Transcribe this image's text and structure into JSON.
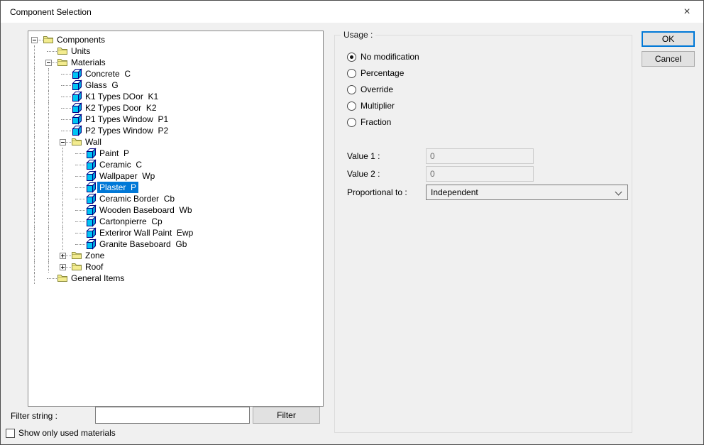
{
  "window": {
    "title": "Component Selection"
  },
  "icons": {
    "close_glyph": "×"
  },
  "tree": {
    "items": [
      {
        "label": "Components",
        "level": 0,
        "icon": "folder",
        "expander": "minus",
        "selected": false
      },
      {
        "label": "Units",
        "level": 1,
        "icon": "folder",
        "expander": null,
        "selected": false
      },
      {
        "label": "Materials",
        "level": 1,
        "icon": "folder",
        "expander": "minus",
        "selected": false
      },
      {
        "label": "Concrete  C",
        "level": 2,
        "icon": "material",
        "expander": null,
        "selected": false
      },
      {
        "label": "Glass  G",
        "level": 2,
        "icon": "material",
        "expander": null,
        "selected": false
      },
      {
        "label": "K1 Types DOor  K1",
        "level": 2,
        "icon": "material",
        "expander": null,
        "selected": false
      },
      {
        "label": "K2 Types Door  K2",
        "level": 2,
        "icon": "material",
        "expander": null,
        "selected": false
      },
      {
        "label": "P1 Types Window  P1",
        "level": 2,
        "icon": "material",
        "expander": null,
        "selected": false
      },
      {
        "label": "P2 Types Window  P2",
        "level": 2,
        "icon": "material",
        "expander": null,
        "selected": false
      },
      {
        "label": "Wall",
        "level": 2,
        "icon": "folder",
        "expander": "minus",
        "selected": false
      },
      {
        "label": "Paint  P",
        "level": 3,
        "icon": "material",
        "expander": null,
        "selected": false
      },
      {
        "label": "Ceramic  C",
        "level": 3,
        "icon": "material",
        "expander": null,
        "selected": false
      },
      {
        "label": "Wallpaper  Wp",
        "level": 3,
        "icon": "material",
        "expander": null,
        "selected": false
      },
      {
        "label": "Plaster  P",
        "level": 3,
        "icon": "material",
        "expander": null,
        "selected": true
      },
      {
        "label": "Ceramic Border  Cb",
        "level": 3,
        "icon": "material",
        "expander": null,
        "selected": false
      },
      {
        "label": "Wooden Baseboard  Wb",
        "level": 3,
        "icon": "material",
        "expander": null,
        "selected": false
      },
      {
        "label": "Cartonpierre  Cp",
        "level": 3,
        "icon": "material",
        "expander": null,
        "selected": false
      },
      {
        "label": "Exteriror Wall Paint  Ewp",
        "level": 3,
        "icon": "material",
        "expander": null,
        "selected": false
      },
      {
        "label": "Granite Baseboard  Gb",
        "level": 3,
        "icon": "material",
        "expander": null,
        "selected": false
      },
      {
        "label": "Zone",
        "level": 2,
        "icon": "folder",
        "expander": "plus",
        "selected": false
      },
      {
        "label": "Roof",
        "level": 2,
        "icon": "folder",
        "expander": "plus",
        "selected": false
      },
      {
        "label": "General Items",
        "level": 1,
        "icon": "folder",
        "expander": null,
        "selected": false
      }
    ]
  },
  "filter": {
    "label": "Filter string :",
    "input_value": "",
    "button_label": "Filter"
  },
  "show_only": {
    "label": "Show only used materials",
    "checked": false
  },
  "usage": {
    "group_label": "Usage :",
    "options": [
      {
        "label": "No modification",
        "selected": true
      },
      {
        "label": "Percentage",
        "selected": false
      },
      {
        "label": "Override",
        "selected": false
      },
      {
        "label": "Multiplier",
        "selected": false
      },
      {
        "label": "Fraction",
        "selected": false
      }
    ],
    "value1": {
      "label": "Value 1 :",
      "value": "0"
    },
    "value2": {
      "label": "Value 2 :",
      "value": "0"
    },
    "proportional": {
      "label": "Proportional to :",
      "value": "Independent"
    }
  },
  "buttons": {
    "ok": "OK",
    "cancel": "Cancel"
  },
  "colors": {
    "selection": "#0078d7",
    "ok_border": "#0078d7",
    "folder": "#f3ec8f",
    "cube": "#00c4f4"
  }
}
